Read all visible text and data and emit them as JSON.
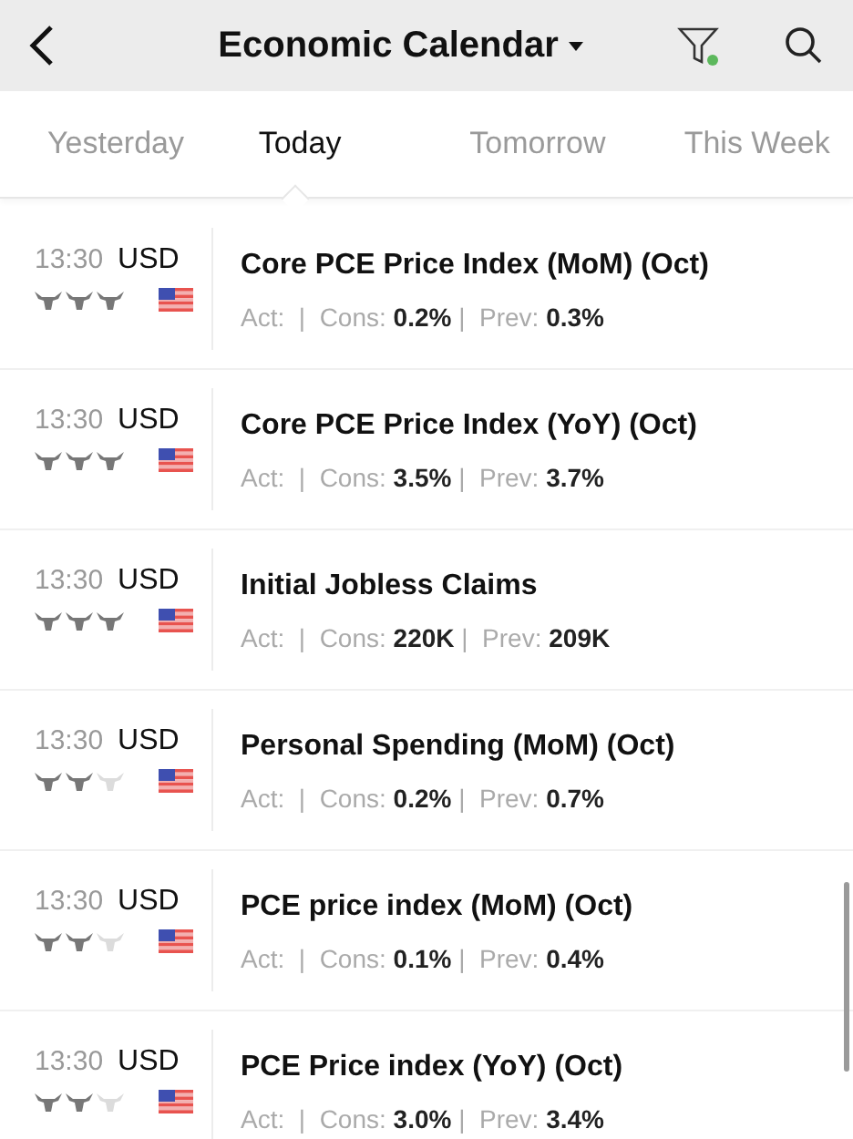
{
  "header": {
    "title": "Economic Calendar",
    "filter_active": true
  },
  "tabs": [
    {
      "label": "Yesterday",
      "selected": false
    },
    {
      "label": "Today",
      "selected": true
    },
    {
      "label": "Tomorrow",
      "selected": false
    },
    {
      "label": "This Week",
      "selected": false
    }
  ],
  "events": [
    {
      "time": "13:30",
      "currency": "USD",
      "stars": 3,
      "name": "Core PCE Price Index (MoM) (Oct)",
      "values": "Act:  |  Cons: **0.2%** |  Prev: **0.3%**"
    },
    {
      "time": "13:30",
      "currency": "USD",
      "stars": 3,
      "name": "Core PCE Price Index (YoY) (Oct)",
      "values": "Act:  |  Cons: **3.5%** |  Prev: **3.7%**"
    },
    {
      "time": "13:30",
      "currency": "USD",
      "stars": 3,
      "name": "Initial Jobless Claims",
      "values": "Act:  |  Cons: **220K** |  Prev: **209K**"
    },
    {
      "time": "13:30",
      "currency": "USD",
      "stars": 2,
      "name": "Personal Spending (MoM) (Oct)",
      "values": "Act:  |  Cons: **0.2%** |  Prev: **0.7%**"
    },
    {
      "time": "13:30",
      "currency": "USD",
      "stars": 2,
      "name": "PCE price index (MoM) (Oct)",
      "values": "Act:  |  Cons: **0.1%** |  Prev: **0.4%**"
    },
    {
      "time": "13:30",
      "currency": "USD",
      "stars": 2,
      "name": "PCE Price index (YoY) (Oct)",
      "values": "Act:  |  Cons: **3.0%** |  Prev: **3.4%**"
    }
  ]
}
